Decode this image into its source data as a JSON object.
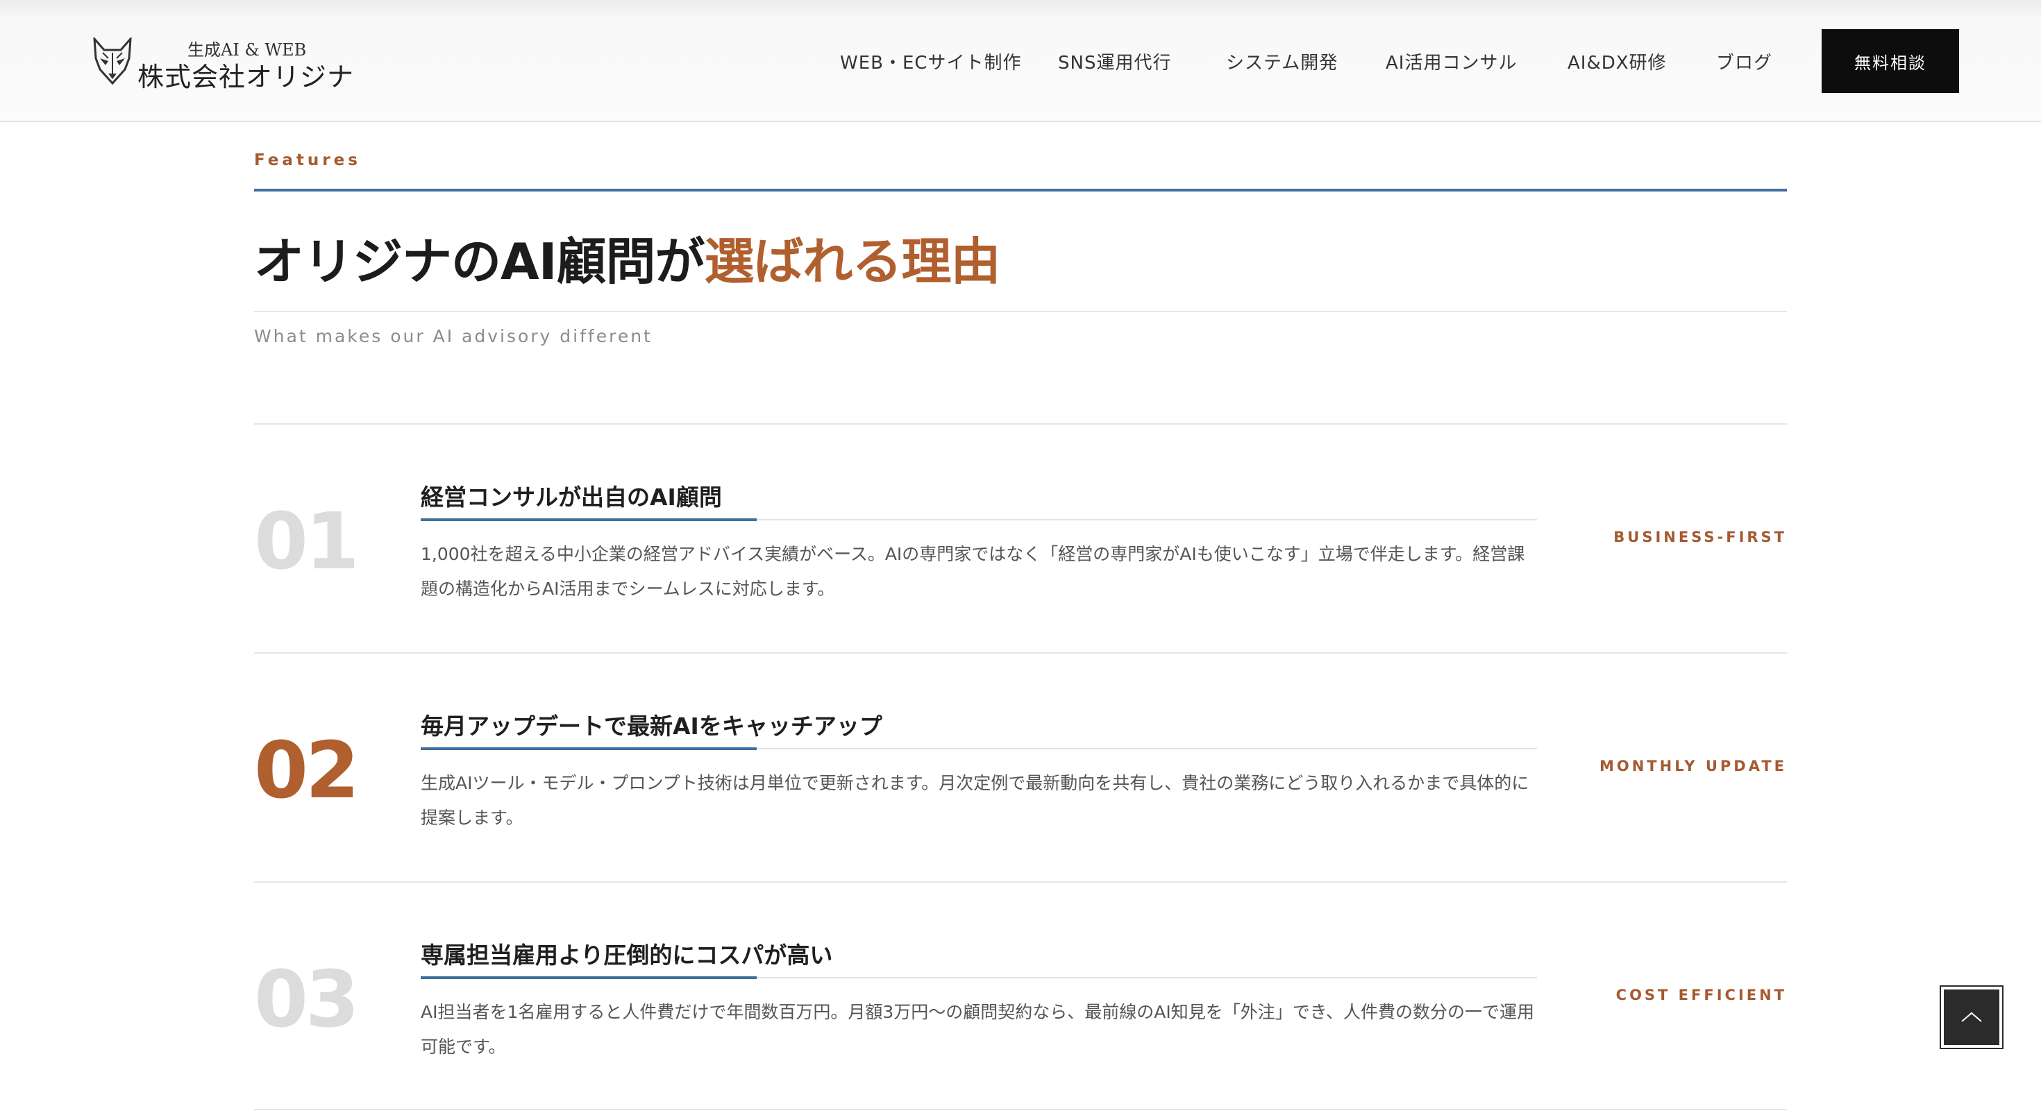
{
  "brand": {
    "subtitle": "生成AI & WEB",
    "name": "株式会社オリジナ"
  },
  "nav": {
    "items": [
      {
        "label": "WEB・ECサイト制作"
      },
      {
        "label": "SNS運用代行"
      },
      {
        "label": "システム開発"
      },
      {
        "label": "AI活用コンサル"
      },
      {
        "label": "AI&DX研修"
      },
      {
        "label": "ブログ"
      }
    ],
    "cta_label": "無料相談"
  },
  "section": {
    "eyebrow": "Features",
    "heading_main": "オリジナのAI顧問が",
    "heading_accent": "選ばれる理由",
    "subheading": "What makes our AI advisory different"
  },
  "features": [
    {
      "number": "01",
      "title": "経営コンサルが出自のAI顧問",
      "description": "1,000社を超える中小企業の経営アドバイス実績がベース。AIの専門家ではなく「経営の専門家がAIも使いこなす」立場で伴走します。経営課題の構造化からAI活用までシームレスに対応します。",
      "tag": "BUSINESS-FIRST"
    },
    {
      "number": "02",
      "title": "毎月アップデートで最新AIをキャッチアップ",
      "description": "生成AIツール・モデル・プロンプト技術は月単位で更新されます。月次定例で最新動向を共有し、貴社の業務にどう取り入れるかまで具体的に提案します。",
      "tag": "MONTHLY UPDATE"
    },
    {
      "number": "03",
      "title": "専属担当雇用より圧倒的にコスパが高い",
      "description": "AI担当者を1名雇用すると人件費だけで年間数百万円。月額3万円〜の顧問契約なら、最前線のAI知見を「外注」でき、人件費の数分の一で運用可能です。",
      "tag": "COST EFFICIENT"
    }
  ],
  "colors": {
    "accent": "#b05f2e",
    "blue": "#3f6f9e",
    "cta_bg": "#0d0d0d"
  }
}
